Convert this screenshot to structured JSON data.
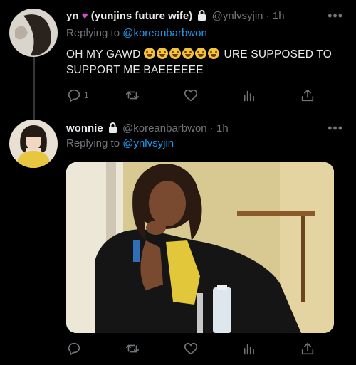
{
  "tweet1": {
    "name": "yn",
    "name_suffix": "(yunjins future wife)",
    "handle": "@ynlvsyjin",
    "time": "· 1h",
    "reply_prefix": "Replying to",
    "reply_handle": "@koreanbarbwon",
    "text_before": "OH MY GAWD",
    "text_after": "URE SUPPOSED TO",
    "text_line2": "SUPPORT ME BAEEEEEE",
    "emoji_name": "loudly-crying-face",
    "emoji_count": 6,
    "reply_count": "1"
  },
  "tweet2": {
    "name": "wonnie",
    "handle": "@koreanbarbwon",
    "time": "· 1h",
    "reply_prefix": "Replying to",
    "reply_handle": "@ynlvsyjin",
    "media_description": "meme image"
  },
  "icons": [
    "reply-icon",
    "retweet-icon",
    "like-icon",
    "analytics-icon",
    "share-icon",
    "lock-icon",
    "more-icon",
    "purple-heart-icon"
  ],
  "colors": {
    "accent": "#1d9bf0",
    "muted": "#71767b",
    "text": "#e7e9ea",
    "background": "#000000"
  }
}
